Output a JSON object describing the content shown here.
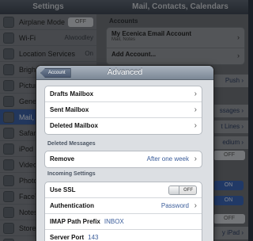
{
  "background": {
    "left_title": "Settings",
    "right_title": "Mail, Contacts, Calendars",
    "settings_items": [
      {
        "label": "Airplane Mode",
        "toggle": "OFF"
      },
      {
        "label": "Wi-Fi",
        "value": "Alwoodley"
      },
      {
        "label": "Location Services",
        "value": "On"
      },
      {
        "label": "Brightne"
      },
      {
        "label": "Picture F"
      },
      {
        "label": "General"
      },
      {
        "label": "Mail, Con",
        "selected": true
      },
      {
        "label": "Safari"
      },
      {
        "label": "iPod"
      },
      {
        "label": "Video"
      },
      {
        "label": "Photos"
      },
      {
        "label": "FaceTim"
      },
      {
        "label": "Notes"
      },
      {
        "label": "Store"
      },
      {
        "label": "BBC iPla"
      }
    ],
    "accounts_header": "Accounts",
    "account_name": "My Ecenica Email Account",
    "account_sub": "Mail, Notes",
    "add_account": "Add Account...",
    "peek_push": "Push",
    "peek_messages": "ssages",
    "peek_lines": "t Lines",
    "peek_medium": "edium",
    "peek_off_top": "OFF",
    "peek_on": "ON",
    "peek_on2": "ON",
    "peek_off_bottom": "OFF",
    "peek_ipad": "y iPad"
  },
  "modal": {
    "back_label": "Account",
    "title": "Advanced",
    "mailboxes": [
      "Drafts Mailbox",
      "Sent Mailbox",
      "Deleted Mailbox"
    ],
    "deleted_header": "Deleted Messages",
    "remove_label": "Remove",
    "remove_value": "After one week",
    "incoming_header": "Incoming Settings",
    "ssl_label": "Use SSL",
    "ssl_value": "OFF",
    "auth_label": "Authentication",
    "auth_value": "Password",
    "imap_label": "IMAP Path Prefix",
    "imap_value": "INBOX",
    "port_label": "Server Port",
    "port_value": "143"
  }
}
